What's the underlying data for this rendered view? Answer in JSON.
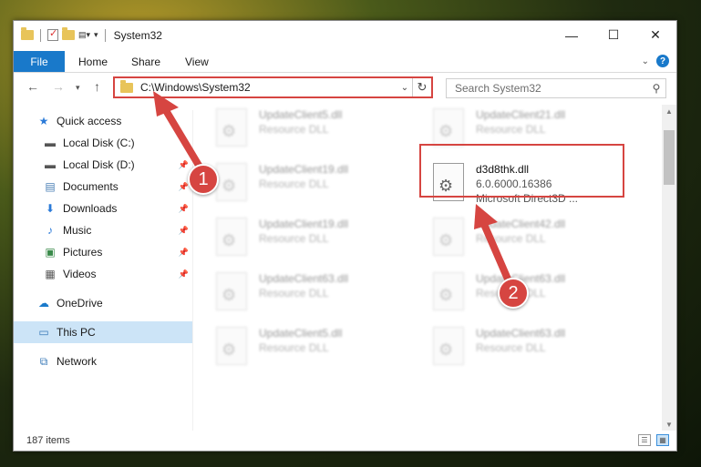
{
  "window": {
    "title": "System32"
  },
  "controls": {
    "minimize": "—",
    "maximize": "☐",
    "close": "✕"
  },
  "ribbon": {
    "file": "File",
    "tabs": [
      "Home",
      "Share",
      "View"
    ]
  },
  "address": {
    "path": "C:\\Windows\\System32"
  },
  "search": {
    "placeholder": "Search System32"
  },
  "sidebar": {
    "quick_access": "Quick access",
    "items": [
      {
        "label": "Local Disk (C:)",
        "icon": "drive-icon",
        "pinned": false
      },
      {
        "label": "Local Disk (D:)",
        "icon": "drive-icon",
        "pinned": true
      },
      {
        "label": "Documents",
        "icon": "documents-icon",
        "pinned": true
      },
      {
        "label": "Downloads",
        "icon": "downloads-icon",
        "pinned": true
      },
      {
        "label": "Music",
        "icon": "music-icon",
        "pinned": true
      },
      {
        "label": "Pictures",
        "icon": "pictures-icon",
        "pinned": true
      },
      {
        "label": "Videos",
        "icon": "videos-icon",
        "pinned": true
      }
    ],
    "onedrive": "OneDrive",
    "this_pc": "This PC",
    "network": "Network"
  },
  "files": [
    {
      "name": "UpdateClient5.dll",
      "type": "Resource DLL"
    },
    {
      "name": "UpdateClient21.dll",
      "type": "Resource DLL"
    },
    {
      "name": "UpdateClient19.dll",
      "type": "Resource DLL"
    },
    {
      "name": "d3d8thk.dll",
      "version": "6.0.6000.16386",
      "description": "Microsoft Direct3D ..."
    },
    {
      "name": "UpdateClient19.dll",
      "type": "Resource DLL"
    },
    {
      "name": "UpdateClient42.dll",
      "type": "Resource DLL"
    },
    {
      "name": "UpdateClient63.dll",
      "type": "Resource DLL"
    },
    {
      "name": "UpdateClient63.dll",
      "type": "Resource DLL"
    },
    {
      "name": "UpdateClient5.dll",
      "type": "Resource DLL"
    },
    {
      "name": "UpdateClient63.dll",
      "type": "Resource DLL"
    }
  ],
  "status": {
    "count": "187 items"
  },
  "annotations": {
    "step1": "1",
    "step2": "2",
    "color": "#d64541"
  }
}
